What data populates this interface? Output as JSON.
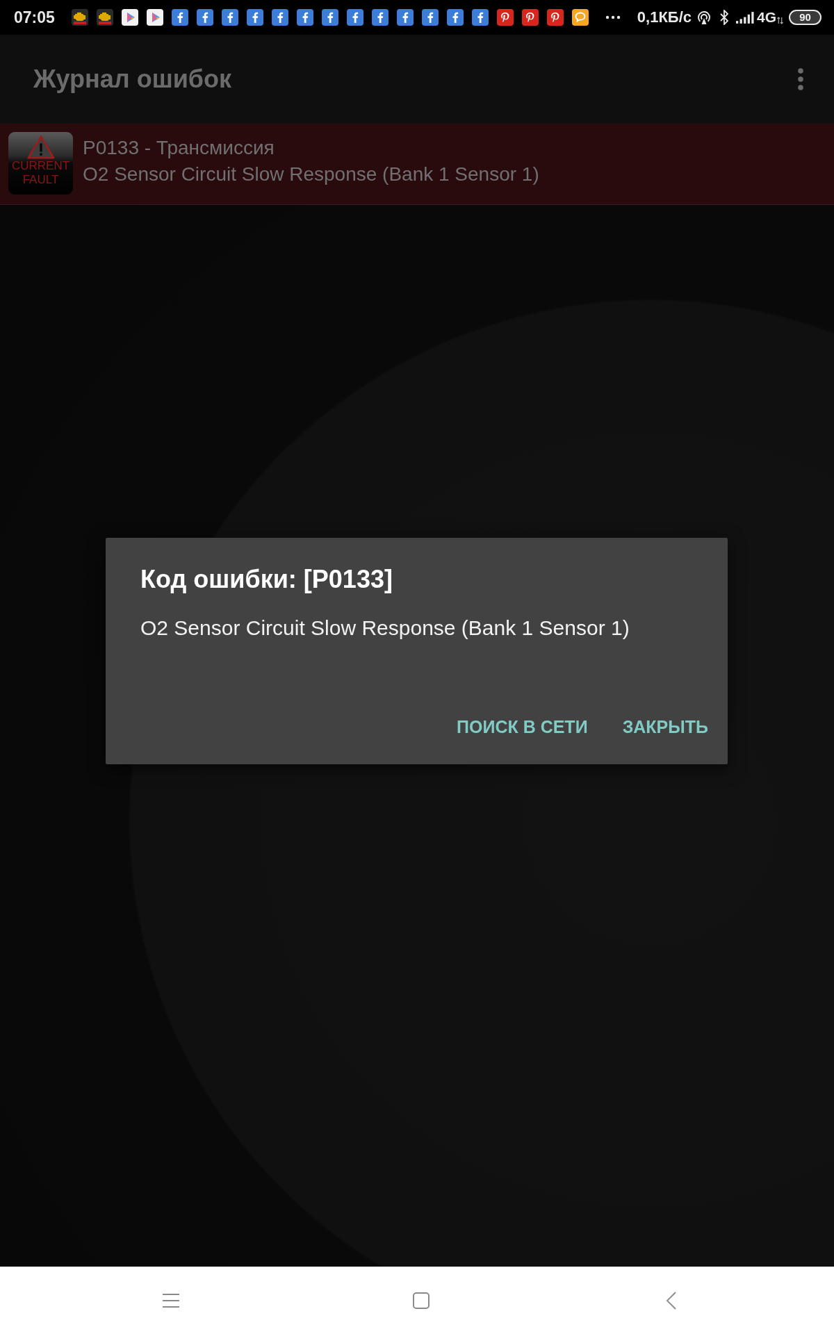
{
  "status_bar": {
    "time": "07:05",
    "notifications": [
      {
        "kind": "engine"
      },
      {
        "kind": "engine"
      },
      {
        "kind": "play"
      },
      {
        "kind": "play"
      },
      {
        "kind": "f"
      },
      {
        "kind": "f"
      },
      {
        "kind": "f"
      },
      {
        "kind": "f"
      },
      {
        "kind": "f"
      },
      {
        "kind": "f"
      },
      {
        "kind": "f"
      },
      {
        "kind": "f"
      },
      {
        "kind": "f"
      },
      {
        "kind": "f"
      },
      {
        "kind": "f"
      },
      {
        "kind": "f"
      },
      {
        "kind": "f"
      },
      {
        "kind": "p"
      },
      {
        "kind": "p"
      },
      {
        "kind": "p"
      },
      {
        "kind": "chat"
      }
    ],
    "net_speed": "0,1КБ/с",
    "network": "4G",
    "battery": "90"
  },
  "app_bar": {
    "title": "Журнал ошибок"
  },
  "faults": [
    {
      "badge": "CURRENT FAULT",
      "title": "P0133 - Трансмиссия",
      "description": "O2 Sensor Circuit Slow Response (Bank 1 Sensor 1)"
    }
  ],
  "dialog": {
    "title": "Код ошибки: [P0133]",
    "message": "O2 Sensor Circuit Slow Response (Bank 1 Sensor 1)",
    "buttons": [
      "ПОИСК В СЕТИ",
      "ЗАКРЫТЬ"
    ]
  }
}
